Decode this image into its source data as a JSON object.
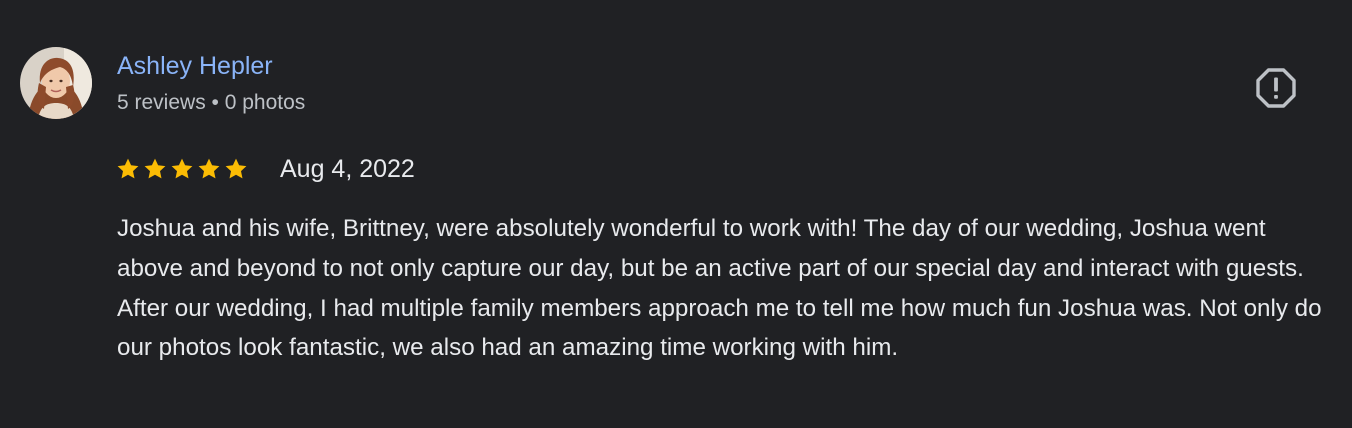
{
  "review": {
    "author": {
      "name": "Ashley Hepler",
      "stats": "5 reviews • 0 photos",
      "avatar": "avatar-photo"
    },
    "rating": {
      "stars": 5,
      "max": 5,
      "star_color": "#fbbc04"
    },
    "date": "Aug 4, 2022",
    "text": "Joshua and his wife, Brittney, were absolutely wonderful to work with! The day of our wedding, Joshua went above and beyond to not only capture our day, but be an active part of our special day and interact with guests. After our wedding, I had multiple family members approach me to tell me how much fun Joshua was. Not only do our photos look fantastic, we also had an amazing time working with him.",
    "actions": {
      "report_icon": "report-exclamation-icon"
    }
  },
  "colors": {
    "background": "#202124",
    "name": "#8ab4f8",
    "text": "#e8eaed",
    "secondary_text": "#bdc1c6"
  }
}
